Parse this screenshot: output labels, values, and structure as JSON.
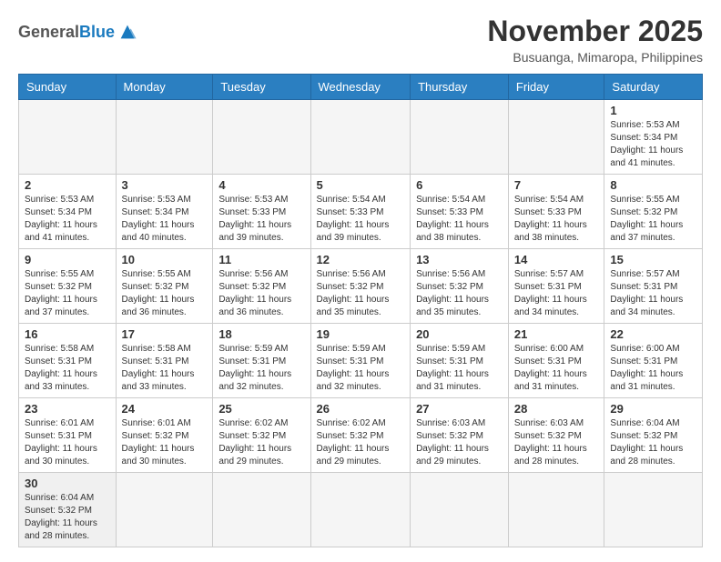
{
  "header": {
    "logo_general": "General",
    "logo_blue": "Blue",
    "month_title": "November 2025",
    "location": "Busuanga, Mimaropa, Philippines"
  },
  "weekdays": [
    "Sunday",
    "Monday",
    "Tuesday",
    "Wednesday",
    "Thursday",
    "Friday",
    "Saturday"
  ],
  "days": {
    "d1": {
      "num": "1",
      "info": "Sunrise: 5:53 AM\nSunset: 5:34 PM\nDaylight: 11 hours\nand 41 minutes."
    },
    "d2": {
      "num": "2",
      "info": "Sunrise: 5:53 AM\nSunset: 5:34 PM\nDaylight: 11 hours\nand 41 minutes."
    },
    "d3": {
      "num": "3",
      "info": "Sunrise: 5:53 AM\nSunset: 5:34 PM\nDaylight: 11 hours\nand 40 minutes."
    },
    "d4": {
      "num": "4",
      "info": "Sunrise: 5:53 AM\nSunset: 5:33 PM\nDaylight: 11 hours\nand 39 minutes."
    },
    "d5": {
      "num": "5",
      "info": "Sunrise: 5:54 AM\nSunset: 5:33 PM\nDaylight: 11 hours\nand 39 minutes."
    },
    "d6": {
      "num": "6",
      "info": "Sunrise: 5:54 AM\nSunset: 5:33 PM\nDaylight: 11 hours\nand 38 minutes."
    },
    "d7": {
      "num": "7",
      "info": "Sunrise: 5:54 AM\nSunset: 5:33 PM\nDaylight: 11 hours\nand 38 minutes."
    },
    "d8": {
      "num": "8",
      "info": "Sunrise: 5:55 AM\nSunset: 5:32 PM\nDaylight: 11 hours\nand 37 minutes."
    },
    "d9": {
      "num": "9",
      "info": "Sunrise: 5:55 AM\nSunset: 5:32 PM\nDaylight: 11 hours\nand 37 minutes."
    },
    "d10": {
      "num": "10",
      "info": "Sunrise: 5:55 AM\nSunset: 5:32 PM\nDaylight: 11 hours\nand 36 minutes."
    },
    "d11": {
      "num": "11",
      "info": "Sunrise: 5:56 AM\nSunset: 5:32 PM\nDaylight: 11 hours\nand 36 minutes."
    },
    "d12": {
      "num": "12",
      "info": "Sunrise: 5:56 AM\nSunset: 5:32 PM\nDaylight: 11 hours\nand 35 minutes."
    },
    "d13": {
      "num": "13",
      "info": "Sunrise: 5:56 AM\nSunset: 5:32 PM\nDaylight: 11 hours\nand 35 minutes."
    },
    "d14": {
      "num": "14",
      "info": "Sunrise: 5:57 AM\nSunset: 5:31 PM\nDaylight: 11 hours\nand 34 minutes."
    },
    "d15": {
      "num": "15",
      "info": "Sunrise: 5:57 AM\nSunset: 5:31 PM\nDaylight: 11 hours\nand 34 minutes."
    },
    "d16": {
      "num": "16",
      "info": "Sunrise: 5:58 AM\nSunset: 5:31 PM\nDaylight: 11 hours\nand 33 minutes."
    },
    "d17": {
      "num": "17",
      "info": "Sunrise: 5:58 AM\nSunset: 5:31 PM\nDaylight: 11 hours\nand 33 minutes."
    },
    "d18": {
      "num": "18",
      "info": "Sunrise: 5:59 AM\nSunset: 5:31 PM\nDaylight: 11 hours\nand 32 minutes."
    },
    "d19": {
      "num": "19",
      "info": "Sunrise: 5:59 AM\nSunset: 5:31 PM\nDaylight: 11 hours\nand 32 minutes."
    },
    "d20": {
      "num": "20",
      "info": "Sunrise: 5:59 AM\nSunset: 5:31 PM\nDaylight: 11 hours\nand 31 minutes."
    },
    "d21": {
      "num": "21",
      "info": "Sunrise: 6:00 AM\nSunset: 5:31 PM\nDaylight: 11 hours\nand 31 minutes."
    },
    "d22": {
      "num": "22",
      "info": "Sunrise: 6:00 AM\nSunset: 5:31 PM\nDaylight: 11 hours\nand 31 minutes."
    },
    "d23": {
      "num": "23",
      "info": "Sunrise: 6:01 AM\nSunset: 5:31 PM\nDaylight: 11 hours\nand 30 minutes."
    },
    "d24": {
      "num": "24",
      "info": "Sunrise: 6:01 AM\nSunset: 5:32 PM\nDaylight: 11 hours\nand 30 minutes."
    },
    "d25": {
      "num": "25",
      "info": "Sunrise: 6:02 AM\nSunset: 5:32 PM\nDaylight: 11 hours\nand 29 minutes."
    },
    "d26": {
      "num": "26",
      "info": "Sunrise: 6:02 AM\nSunset: 5:32 PM\nDaylight: 11 hours\nand 29 minutes."
    },
    "d27": {
      "num": "27",
      "info": "Sunrise: 6:03 AM\nSunset: 5:32 PM\nDaylight: 11 hours\nand 29 minutes."
    },
    "d28": {
      "num": "28",
      "info": "Sunrise: 6:03 AM\nSunset: 5:32 PM\nDaylight: 11 hours\nand 28 minutes."
    },
    "d29": {
      "num": "29",
      "info": "Sunrise: 6:04 AM\nSunset: 5:32 PM\nDaylight: 11 hours\nand 28 minutes."
    },
    "d30": {
      "num": "30",
      "info": "Sunrise: 6:04 AM\nSunset: 5:32 PM\nDaylight: 11 hours\nand 28 minutes."
    }
  }
}
